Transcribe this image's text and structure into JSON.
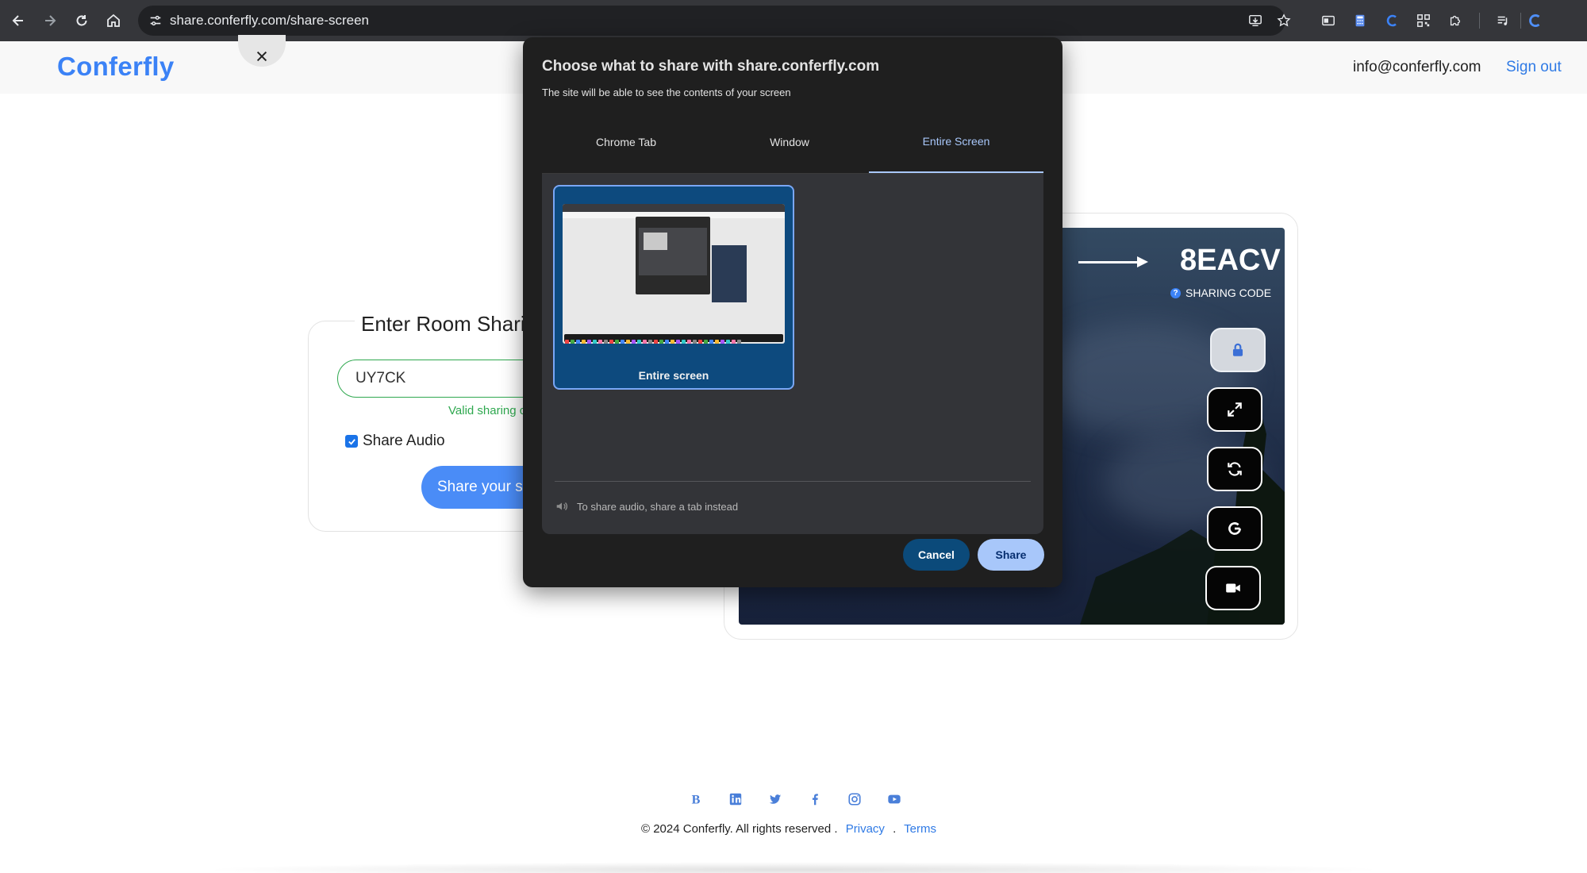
{
  "browser": {
    "url": "share.conferfly.com/share-screen",
    "icons": [
      "back-icon",
      "forward-icon",
      "reload-icon",
      "home-icon",
      "site-info-icon",
      "install-icon",
      "bookmark-star-icon",
      "sidebar-icon",
      "calculator-icon",
      "extension-c-icon",
      "qr-code-icon",
      "puzzle-icon",
      "media-control-icon",
      "profile-c-icon"
    ]
  },
  "header": {
    "logo": "Conferfly",
    "email": "info@conferfly.com",
    "signout": "Sign out"
  },
  "room": {
    "title": "Enter Room Sharing Code",
    "code_value": "UY7CK",
    "valid_text": "Valid sharing code",
    "audio_label": "Share Audio",
    "share_button": "Share your screen"
  },
  "preview": {
    "code": "8EACV",
    "code_label": "SHARING CODE",
    "controls": [
      "lock-icon",
      "expand-icon",
      "refresh-icon",
      "google-icon",
      "video-camera-icon"
    ]
  },
  "dialog": {
    "title": "Choose what to share with share.conferfly.com",
    "subtitle": "The site will be able to see the contents of your screen",
    "tabs": [
      {
        "label": "Chrome Tab",
        "active": false
      },
      {
        "label": "Window",
        "active": false
      },
      {
        "label": "Entire Screen",
        "active": true
      }
    ],
    "thumbnail_label": "Entire screen",
    "audio_hint": "To share audio, share a tab instead",
    "cancel": "Cancel",
    "share": "Share"
  },
  "footer": {
    "copyright": "© 2024 Conferfly. All rights reserved .",
    "privacy": "Privacy",
    "sep": ".",
    "terms": "Terms",
    "socials": [
      "blogger-b-icon",
      "linkedin-icon",
      "twitter-icon",
      "facebook-icon",
      "instagram-icon",
      "youtube-icon"
    ]
  },
  "colors": {
    "brand": "#3b82f6",
    "valid": "#2fa84f",
    "dialog_bg": "#1f1f1f",
    "accent_tab": "#a8c7fa"
  }
}
